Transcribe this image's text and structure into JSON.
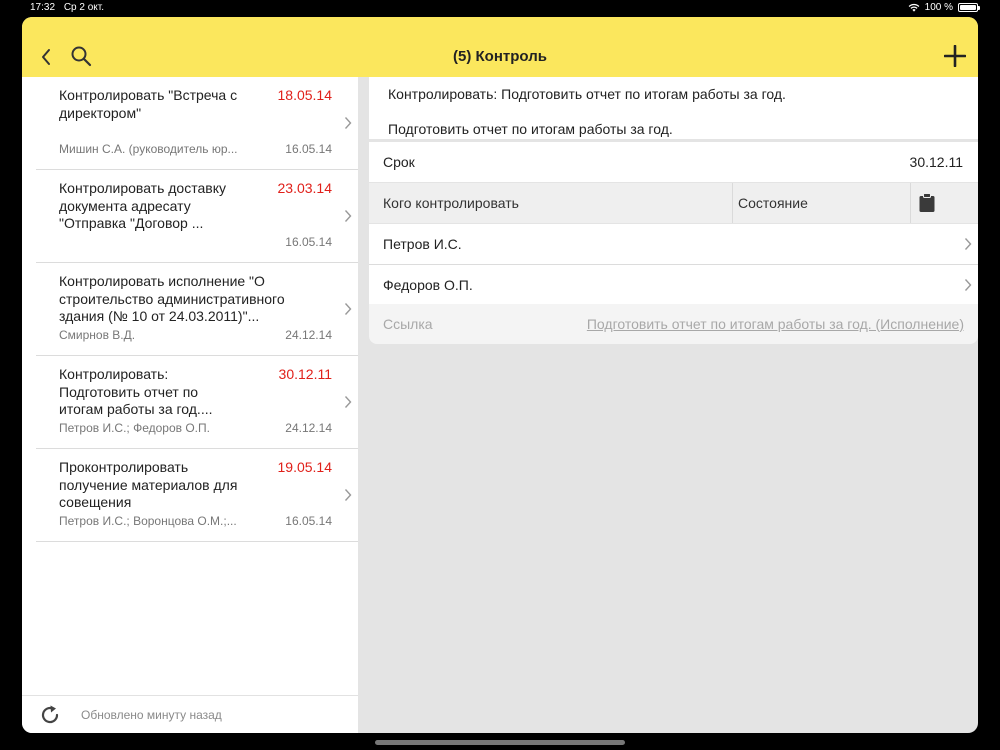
{
  "status_bar": {
    "time": "17:32",
    "date": "Ср 2 окт.",
    "battery": "100 %"
  },
  "navbar": {
    "title": "(5) Контроль",
    "back_icon": "chevron-left-icon",
    "search_icon": "search-icon",
    "add_icon": "plus-icon"
  },
  "list": {
    "items": [
      {
        "title": "Контролировать \"Встреча с директором\"",
        "date": "18.05.14",
        "subtitle": "Мишин С.А. (руководитель юр...",
        "subdate": "16.05.14"
      },
      {
        "title": "Контролировать доставку документа адресату \"Отправка \"Договор ...",
        "date": "23.03.14",
        "subtitle": "",
        "subdate": "16.05.14"
      },
      {
        "title": "Контролировать исполнение \"О строительство административного здания (№ 10 от 24.03.2011)\"...",
        "date": "",
        "subtitle": "Смирнов В.Д.",
        "subdate": "24.12.14"
      },
      {
        "title": "Контролировать: Подготовить отчет по итогам работы за год....",
        "date": "30.12.11",
        "subtitle": "Петров И.С.; Федоров О.П.",
        "subdate": "24.12.14"
      },
      {
        "title": "Проконтролировать получение материалов для совещения",
        "date": "19.05.14",
        "subtitle": "Петров И.С.; Воронцова О.М.;...",
        "subdate": "16.05.14"
      }
    ],
    "footer_text": "Обновлено минуту назад"
  },
  "detail": {
    "heading": "Контролировать: Подготовить отчет по итогам работы за год.",
    "description": "Подготовить отчет по итогам работы за год.",
    "deadline_label": "Срок",
    "deadline_value": "30.12.11",
    "table_header": {
      "who": "Кого контролировать",
      "state": "Состояние"
    },
    "people": [
      "Петров И.С.",
      "Федоров О.П."
    ],
    "link_label": "Ссылка",
    "link_value": "Подготовить отчет по итогам работы за год. (Исполнение)"
  },
  "colors": {
    "accent": "#fbe75d",
    "overdue": "#e0201a"
  }
}
